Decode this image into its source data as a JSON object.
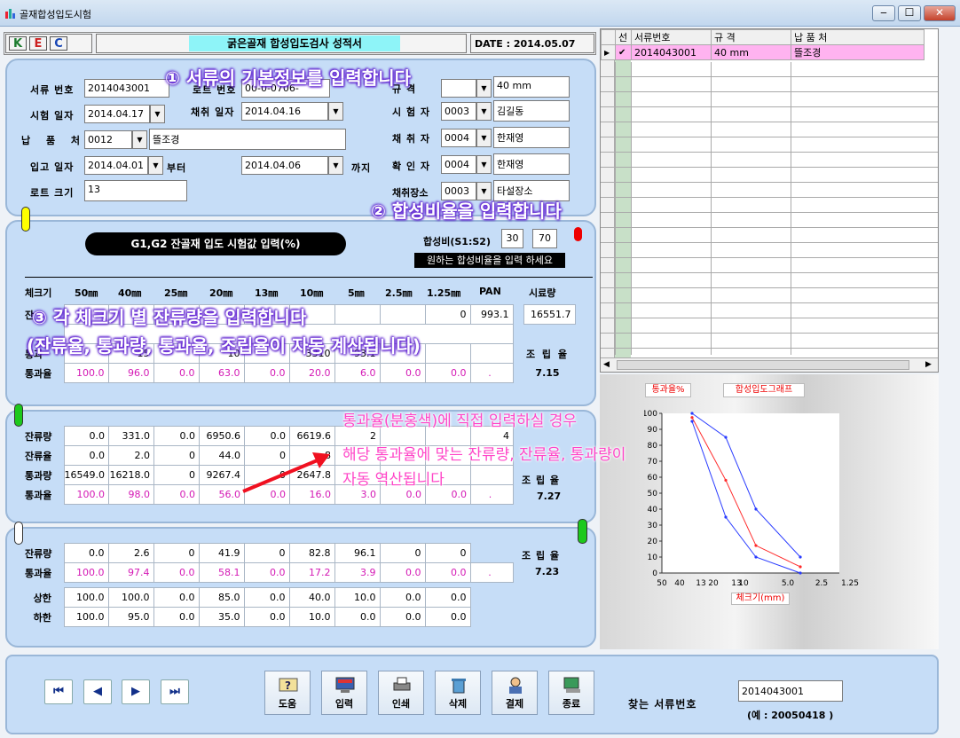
{
  "window": {
    "title": "골재합성입도시험",
    "min": "‒",
    "max": "☐",
    "close": "✕"
  },
  "header": {
    "logo": [
      "K",
      "E",
      "C"
    ],
    "report_title": "굵은골재 합성입도검사 성적서",
    "date": "DATE : 2014.05.07"
  },
  "form": {
    "doc_no_label": "서류 번호",
    "doc_no": "2014043001",
    "lot_no_label": "로트 번호",
    "lot_no": "00-0-0706-",
    "spec_label": "규 격",
    "spec": "40 mm",
    "test_date_label": "시험 일자",
    "test_date": "2014.04.17",
    "sample_date_label": "채취 일자",
    "sample_date": "2014.04.16",
    "tester_label": "시 험 자",
    "tester_code": "0003",
    "tester_name": "김길동",
    "supplier_label": "납 품 처",
    "supplier_code": "0012",
    "supplier_name": "뜰조경",
    "sampler_label": "채 취 자",
    "sampler_code": "0004",
    "sampler_name": "한재영",
    "receive_label": "입고 일자",
    "receive_from": "2014.04.01",
    "from_label": "부터",
    "receive_to": "2014.04.06",
    "to_label": "까지",
    "checker_label": "확 인 자",
    "checker_code": "0004",
    "checker_name": "한재영",
    "lot_size_label": "로트 크기",
    "lot_size": "13",
    "place_label": "채취장소",
    "place_code": "0003",
    "place_name": "타설장소"
  },
  "annotations": {
    "a1": "① 서류의 기본정보를 입력합니다",
    "a2": "② 합성비율을 입력합니다",
    "a3_line1": "③ 각 체크기 별 잔류량을 입력합니다",
    "a3_line2": "(잔류율, 통과량, 통과율, 조립율이 자동 계산됩니다)",
    "b_line1": "통과율(분홍색)에 직접 입력하실 경우",
    "b_line2": "해당 통과율에 맞는 잔류량, 잔류율, 통과량이",
    "b_line3": "자동 역산됩니다"
  },
  "ratio": {
    "section_title": "G1,G2 잔골재 입도 시험값 입력(%)",
    "label": "합성비(S1:S2)",
    "s1": "30",
    "s2": "70",
    "hint": "원하는 합성비율을 입력 하세요"
  },
  "sieve_header": {
    "row_label": "체크기",
    "sizes": [
      "50㎜",
      "40㎜",
      "25㎜",
      "20㎜",
      "13㎜",
      "10㎜",
      "5㎜",
      "2.5㎜",
      "1.25㎜",
      "PAN"
    ],
    "sample_label": "시료량"
  },
  "g1": {
    "retained_partial": [
      "",
      "",
      "",
      "",
      "",
      "",
      "",
      "",
      "0",
      "993.1"
    ],
    "sample_qty": "16551.7",
    "retain_label": "잔",
    "pass_qty_label": "통과",
    "pass_label": "통과율",
    "pass_qty_partial": [
      "",
      "15",
      "",
      "10",
      "",
      "3310",
      "93.1",
      "",
      "",
      ""
    ],
    "pass": [
      "100.0",
      "96.0",
      "0.0",
      "63.0",
      "0.0",
      "20.0",
      "6.0",
      "0.0",
      "0.0",
      "."
    ],
    "fm_label": "조 립 율",
    "fm": "7.15"
  },
  "g2": {
    "retained_label": "잔류량",
    "retained": [
      "0.0",
      "331.0",
      "0.0",
      "6950.6",
      "0.0",
      "6619.6",
      "2",
      "",
      "",
      "4"
    ],
    "rrate_label": "잔류율",
    "rrate": [
      "0.0",
      "2.0",
      "0",
      "44.0",
      "0",
      "8",
      "",
      "",
      "",
      ""
    ],
    "pqty_label": "통과량",
    "pqty": [
      "16549.0",
      "16218.0",
      "0",
      "9267.4",
      "0",
      "2647.8",
      "",
      "",
      "",
      ""
    ],
    "pass_label": "통과율",
    "pass": [
      "100.0",
      "98.0",
      "0.0",
      "56.0",
      "0.0",
      "16.0",
      "3.0",
      "0.0",
      "0.0",
      "."
    ],
    "fm_label": "조 립 율",
    "fm": "7.27"
  },
  "g3": {
    "retained_label": "잔류량",
    "retained": [
      "0.0",
      "2.6",
      "0",
      "41.9",
      "0",
      "82.8",
      "96.1",
      "0",
      "0",
      ""
    ],
    "pass_label": "통과율",
    "pass": [
      "100.0",
      "97.4",
      "0.0",
      "58.1",
      "0.0",
      "17.2",
      "3.9",
      "0.0",
      "0.0",
      "."
    ],
    "upper_label": "상한",
    "upper": [
      "100.0",
      "100.0",
      "0.0",
      "85.0",
      "0.0",
      "40.0",
      "10.0",
      "0.0",
      "0.0"
    ],
    "lower_label": "하한",
    "lower": [
      "100.0",
      "95.0",
      "0.0",
      "35.0",
      "0.0",
      "10.0",
      "0.0",
      "0.0",
      "0.0"
    ],
    "fm_label": "조 립 율",
    "fm": "7.23"
  },
  "list": {
    "headers": [
      "선",
      "서류번호",
      "규 격",
      "납 품 처"
    ],
    "rows": [
      {
        "checked": "✔",
        "doc": "2014043001",
        "spec": "40 mm",
        "supplier": "뜰조경"
      }
    ]
  },
  "graph": {
    "btn_pass": "통과율%",
    "btn_graph": "합성입도그래프",
    "xlabel": "체크기(mm)"
  },
  "chart_data": {
    "type": "line",
    "x_ticks": [
      "50",
      "40",
      "13",
      "20",
      "13",
      "10",
      "5.0",
      "2.5",
      "1.25"
    ],
    "y_ticks": [
      "0",
      "10",
      "20",
      "30",
      "40",
      "50",
      "60",
      "70",
      "80",
      "90",
      "100"
    ],
    "ylim": [
      0,
      100
    ],
    "series": [
      {
        "color": "#ff2a2a",
        "x": [
          "40",
          "20",
          "10",
          "5.0"
        ],
        "values": [
          97.4,
          58.1,
          17.2,
          3.9
        ]
      },
      {
        "color": "#2a3cff",
        "x": [
          "40",
          "20",
          "10",
          "5.0"
        ],
        "values": [
          100,
          85,
          40,
          10
        ]
      },
      {
        "color": "#2a3cff",
        "x": [
          "40",
          "20",
          "10",
          "5.0"
        ],
        "values": [
          95,
          35,
          10,
          0
        ]
      }
    ]
  },
  "bottom": {
    "nav": [
      "⏮",
      "◀",
      "▶",
      "⏭"
    ],
    "buttons": [
      "도움",
      "입력",
      "인쇄",
      "삭제",
      "결제",
      "종료"
    ],
    "search_label": "찾는 서류번호",
    "search_value": "2014043001",
    "search_hint": "(예 : 20050418 )"
  }
}
